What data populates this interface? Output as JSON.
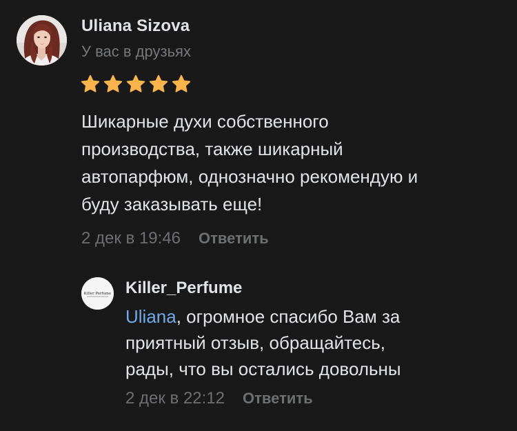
{
  "review": {
    "author": "Uliana Sizova",
    "status": "У вас в друзьях",
    "rating": 5,
    "star_color": "#f9b54c",
    "text_lines": [
      "Шикарные духи собственного",
      "производства, также шикарный",
      "автопарфюм, однозначно рекомендую и",
      "буду заказывать еще!"
    ],
    "date": "2 дек в 19:46",
    "reply_label": "Ответить"
  },
  "reply": {
    "author": "Killer_Perfume",
    "avatar_logo": "Killer Perfume",
    "mention": "Uliana",
    "mention_color": "#71aaeb",
    "text_lines": [
      ", огромное спасибо Вам за",
      "приятный отзыв, обращайтесь,",
      "рады, что вы остались довольны"
    ],
    "date": "2 дек в 22:12",
    "reply_label": "Ответить"
  }
}
